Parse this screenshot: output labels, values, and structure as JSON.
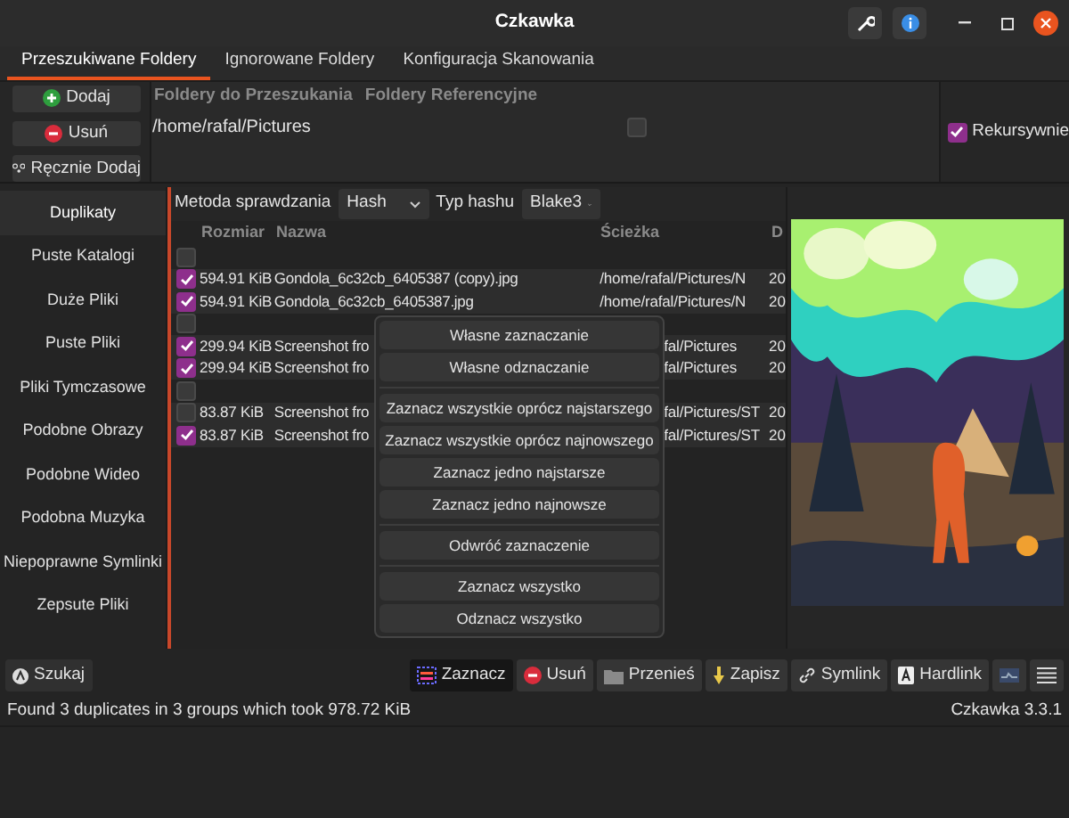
{
  "window": {
    "title": "Czkawka"
  },
  "tabs": [
    {
      "label": "Przeszukiwane Foldery",
      "selected": true
    },
    {
      "label": "Ignorowane Foldery",
      "selected": false
    },
    {
      "label": "Konfiguracja Skanowania",
      "selected": false
    }
  ],
  "folder_buttons": [
    {
      "label": "Dodaj",
      "kind": "add"
    },
    {
      "label": "Usuń",
      "kind": "remove"
    },
    {
      "label": "Ręcznie Dodaj",
      "kind": "manual"
    }
  ],
  "folders": {
    "columns": [
      "Foldery do Przeszukania",
      "Foldery Referencyjne"
    ],
    "rows": [
      {
        "path": "/home/rafal/Pictures",
        "reference": false
      }
    ]
  },
  "recursive": {
    "label": "Rekursywnie",
    "checked": true
  },
  "sidebar": {
    "items": [
      {
        "label": "Duplikaty",
        "selected": true
      },
      {
        "label": "Puste Katalogi",
        "selected": false
      },
      {
        "label": "Duże Pliki",
        "selected": false
      },
      {
        "label": "Puste Pliki",
        "selected": false
      },
      {
        "label": "Pliki Tymczasowe",
        "selected": false
      },
      {
        "label": "Podobne Obrazy",
        "selected": false
      },
      {
        "label": "Podobne Wideo",
        "selected": false
      },
      {
        "label": "Podobna Muzyka",
        "selected": false
      },
      {
        "label": "Niepoprawne Symlinki",
        "selected": false
      },
      {
        "label": "Zepsute Pliki",
        "selected": false
      }
    ]
  },
  "options": [
    {
      "label": "Metoda sprawdzania",
      "value": "Hash"
    },
    {
      "label": "Typ hashu",
      "value": "Blake3"
    }
  ],
  "table": {
    "columns": [
      "Rozmiar",
      "Nazwa",
      "Ścieżka",
      "D"
    ],
    "rows": [
      {
        "kind": "group",
        "checked": false
      },
      {
        "kind": "file",
        "checked": true,
        "size": "594.91 KiB",
        "name": "Gondola_6c32cb_6405387 (copy).jpg",
        "path": "/home/rafal/Pictures/N",
        "date": "20",
        "covered": false
      },
      {
        "kind": "file",
        "checked": true,
        "size": "594.91 KiB",
        "name": "Gondola_6c32cb_6405387.jpg",
        "path": "/home/rafal/Pictures/N",
        "date": "20",
        "covered": false
      },
      {
        "kind": "group",
        "checked": false
      },
      {
        "kind": "file",
        "checked": true,
        "size": "299.94 KiB",
        "name": "Screenshot fro",
        "path": "fal/Pictures",
        "date": "20",
        "covered": true
      },
      {
        "kind": "file",
        "checked": true,
        "size": "299.94 KiB",
        "name": "Screenshot fro",
        "path": "fal/Pictures",
        "date": "20",
        "covered": true
      },
      {
        "kind": "group",
        "checked": false
      },
      {
        "kind": "file",
        "checked": false,
        "size": "83.87 KiB",
        "name": "Screenshot fro",
        "path": "fal/Pictures/ST",
        "date": "20",
        "covered": true
      },
      {
        "kind": "file",
        "checked": true,
        "size": "83.87 KiB",
        "name": "Screenshot fro",
        "path": "fal/Pictures/ST",
        "date": "20",
        "covered": true
      }
    ]
  },
  "select_menu": {
    "groups": [
      [
        "Własne zaznaczanie",
        "Własne odznaczanie"
      ],
      [
        "Zaznacz wszystkie oprócz najstarszego",
        "Zaznacz wszystkie oprócz najnowszego",
        "Zaznacz jedno najstarsze",
        "Zaznacz jedno najnowsze"
      ],
      [
        "Odwróć zaznaczenie"
      ],
      [
        "Zaznacz wszystko",
        "Odznacz wszystko"
      ]
    ]
  },
  "toolbar": {
    "search": "Szukaj",
    "buttons": [
      {
        "label": "Zaznacz",
        "kind": "select",
        "selected": true
      },
      {
        "label": "Usuń",
        "kind": "delete",
        "selected": false
      },
      {
        "label": "Przenieś",
        "kind": "move",
        "selected": false
      },
      {
        "label": "Zapisz",
        "kind": "save",
        "selected": false
      },
      {
        "label": "Symlink",
        "kind": "symlink",
        "selected": false
      },
      {
        "label": "Hardlink",
        "kind": "hardlink",
        "selected": false
      },
      {
        "kind": "preview",
        "selected": false
      },
      {
        "kind": "menu",
        "selected": false
      }
    ]
  },
  "status_bar": {
    "message": "Found 3 duplicates in 3 groups which took 978.72 KiB",
    "version": "Czkawka 3.3.1"
  }
}
